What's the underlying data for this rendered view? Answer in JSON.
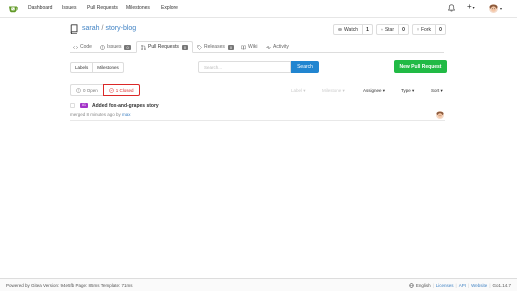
{
  "nav": {
    "items": [
      "Dashboard",
      "Issues",
      "Pull Requests",
      "Milestones",
      "Explore"
    ]
  },
  "repo": {
    "owner": "sarah",
    "separator": "/",
    "name": "story-blog"
  },
  "actions": {
    "watch": {
      "label": "Watch",
      "count": "1"
    },
    "star": {
      "label": "Star",
      "count": "0"
    },
    "fork": {
      "label": "Fork",
      "count": "0"
    }
  },
  "tabs": [
    {
      "label": "Code",
      "count": "",
      "icon": "code-icon"
    },
    {
      "label": "Issues",
      "count": "0",
      "icon": "issue-icon"
    },
    {
      "label": "Pull Requests",
      "count": "0",
      "icon": "pull-request-icon"
    },
    {
      "label": "Releases",
      "count": "0",
      "icon": "tag-icon"
    },
    {
      "label": "Wiki",
      "count": "",
      "icon": "book-icon"
    },
    {
      "label": "Activity",
      "count": "",
      "icon": "pulse-icon"
    }
  ],
  "toolbar": {
    "labels": "Labels",
    "milestones": "Milestones",
    "search_placeholder": "Search...",
    "search_button": "Search",
    "new_pr": "New Pull Request"
  },
  "states": {
    "open": "0 Open",
    "closed": "1 Closed"
  },
  "filters": {
    "label": "Label",
    "milestone": "Milestone",
    "assignee": "Assignee",
    "type": "Type",
    "sort": "Sort"
  },
  "pull_requests": [
    {
      "number": "#1",
      "title": "Added fox-and-grapes story",
      "meta_prefix": "merged 8 minutes ago by",
      "author": "max"
    }
  ],
  "footer": {
    "powered": "Powered by Gitea Version: 94e5fb Page: 85ms Template: 71ms",
    "language": "English",
    "licenses": "Licenses",
    "api": "API",
    "website": "Website",
    "go_version": "Go1.14.7"
  },
  "colors": {
    "accent": "#2185d0",
    "success": "#21ba45",
    "danger": "#db2828",
    "link": "#4183c4",
    "pr_badge": "#a333c8"
  }
}
